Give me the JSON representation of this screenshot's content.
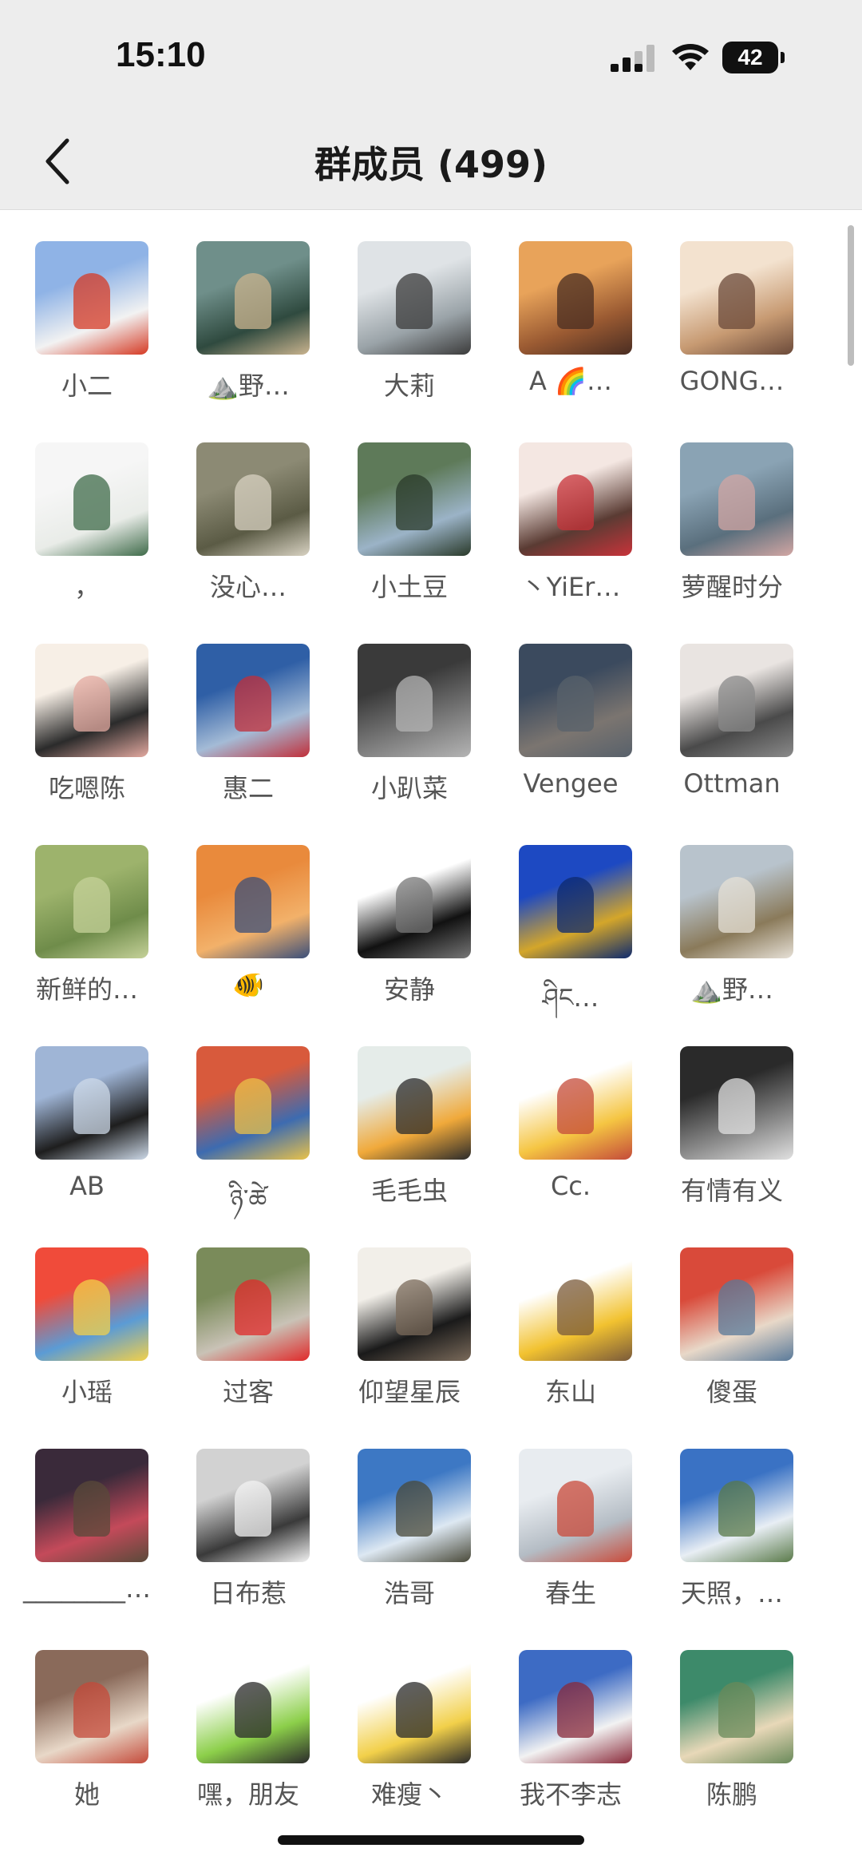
{
  "status": {
    "time": "15:10",
    "battery": "42"
  },
  "nav": {
    "title": "群成员 (499)"
  },
  "members": [
    {
      "name": "小二",
      "avatar": "snow-hiker-photo",
      "colors": [
        "#8fb3e6",
        "#f2f2f2",
        "#d53a24"
      ]
    },
    {
      "name": "⛰️野…",
      "avatar": "cat-lake-photo",
      "colors": [
        "#6f8f8a",
        "#2f4a3f",
        "#c9b38e"
      ]
    },
    {
      "name": "大莉",
      "avatar": "woman-snow-photo",
      "colors": [
        "#dfe3e6",
        "#9aa3a8",
        "#3b3b3b"
      ]
    },
    {
      "name": "A 🌈…",
      "avatar": "sunset-woman-photo",
      "colors": [
        "#e8a35a",
        "#9a5a32",
        "#4a2d22"
      ]
    },
    {
      "name": "GONG…",
      "avatar": "baby-cake-photo",
      "colors": [
        "#f3e2cf",
        "#c79a72",
        "#6b4a3a"
      ]
    },
    {
      "name": "，",
      "avatar": "agave-plant-photo",
      "colors": [
        "#f6f6f6",
        "#e9ece8",
        "#3f6b4a"
      ]
    },
    {
      "name": "没心…",
      "avatar": "forest-photo",
      "colors": [
        "#8c8a74",
        "#5b5b45",
        "#d8d2c2"
      ]
    },
    {
      "name": "小土豆",
      "avatar": "hill-person-photo",
      "colors": [
        "#5e7a59",
        "#9bb3c7",
        "#2a3a2a"
      ]
    },
    {
      "name": "丶YiEr…",
      "avatar": "girl-illustration",
      "colors": [
        "#f4e7e2",
        "#5a3b33",
        "#c8333a"
      ]
    },
    {
      "name": "萝醒时分",
      "avatar": "lake-woman-photo",
      "colors": [
        "#8aa3b4",
        "#5a6f7d",
        "#d2a6a3"
      ]
    },
    {
      "name": "吃嗯陈",
      "avatar": "meditation-illustration",
      "colors": [
        "#f7efe6",
        "#2b2b2b",
        "#e3a9a0"
      ]
    },
    {
      "name": "惠二",
      "avatar": "mountain-hiker-photo",
      "colors": [
        "#2f5fa6",
        "#a4bbd6",
        "#c12f3a"
      ]
    },
    {
      "name": "小趴菜",
      "avatar": "dark-portrait-photo",
      "colors": [
        "#3a3a3a",
        "#7d7d7d",
        "#b4b4b4"
      ]
    },
    {
      "name": "Vengee",
      "avatar": "abstract-photo",
      "colors": [
        "#3b4a5e",
        "#7b7570",
        "#58616b"
      ]
    },
    {
      "name": "Ottman",
      "avatar": "soldier-sketch",
      "colors": [
        "#e9e4e1",
        "#4a4a4a",
        "#8a8a8a"
      ]
    },
    {
      "name": "新鲜的…",
      "avatar": "green-field-photo",
      "colors": [
        "#9db36c",
        "#6f8c4a",
        "#c5d199"
      ]
    },
    {
      "name": "🐠",
      "avatar": "sunset-mountains-photo",
      "colors": [
        "#e98a3c",
        "#f2b16a",
        "#3b4f7a"
      ]
    },
    {
      "name": "安静",
      "avatar": "anime-boy-sketch",
      "colors": [
        "#ffffff",
        "#111111",
        "#777777"
      ]
    },
    {
      "name": "ཤིང…",
      "avatar": "golden-statue-photo",
      "colors": [
        "#1d49c2",
        "#d4a62a",
        "#0e2a6e"
      ]
    },
    {
      "name": "⛰️野…",
      "avatar": "field-person-photo",
      "colors": [
        "#b8c3cc",
        "#8a7a5a",
        "#e6e0d6"
      ]
    },
    {
      "name": "AB",
      "avatar": "hooded-figure-photo",
      "colors": [
        "#9fb5d6",
        "#1e1e1e",
        "#cdd9e8"
      ]
    },
    {
      "name": "ཉི་ཚེ",
      "avatar": "prayer-flags-photo",
      "colors": [
        "#d85a3c",
        "#3d6bb0",
        "#e9c24a"
      ]
    },
    {
      "name": "毛毛虫",
      "avatar": "scooter-cartoon",
      "colors": [
        "#e5ece9",
        "#f0a93a",
        "#2b2b2b"
      ]
    },
    {
      "name": "Cc.",
      "avatar": "brick-worker-cartoon",
      "colors": [
        "#ffffff",
        "#f5c542",
        "#c44b3a"
      ]
    },
    {
      "name": "有情有义",
      "avatar": "silhouette-sun-photo",
      "colors": [
        "#2a2a2a",
        "#8a8a8a",
        "#e0e0e0"
      ]
    },
    {
      "name": "小瑶",
      "avatar": "red-costume-photo",
      "colors": [
        "#f04b3a",
        "#5b9bd5",
        "#f2d04a"
      ]
    },
    {
      "name": "过客",
      "avatar": "stone-flag-photo",
      "colors": [
        "#7a8b5a",
        "#c9c2b6",
        "#e02a2a"
      ]
    },
    {
      "name": "仰望星辰",
      "avatar": "calligraphy-poster",
      "colors": [
        "#f2efe9",
        "#1a1a1a",
        "#7a6a5a"
      ]
    },
    {
      "name": "东山",
      "avatar": "fishing-cartoon",
      "colors": [
        "#ffffff",
        "#f2c230",
        "#7a5a3a"
      ]
    },
    {
      "name": "傻蛋",
      "avatar": "cap-man-photo",
      "colors": [
        "#d94a3a",
        "#e8d8c8",
        "#5a7a9a"
      ]
    },
    {
      "name": "________…",
      "avatar": "neon-street-photo",
      "colors": [
        "#3a2a3a",
        "#c44a5a",
        "#5a4a3a"
      ]
    },
    {
      "name": "日布惹",
      "avatar": "group-photo",
      "colors": [
        "#d2d2d2",
        "#3a3a3a",
        "#f2f2f2"
      ]
    },
    {
      "name": "浩哥",
      "avatar": "sea-of-clouds-photo",
      "colors": [
        "#3d78c4",
        "#dde8f2",
        "#4a4a3a"
      ]
    },
    {
      "name": "春生",
      "avatar": "snow-field-photo",
      "colors": [
        "#e8ecf0",
        "#b4bcc4",
        "#c94a3a"
      ]
    },
    {
      "name": "天照，…",
      "avatar": "mountain-road-photo",
      "colors": [
        "#3a72c4",
        "#e8eef4",
        "#5a7a4a"
      ]
    },
    {
      "name": "她",
      "avatar": "cat-meme-photo",
      "colors": [
        "#8a6a5a",
        "#e8d8c8",
        "#c44a3a"
      ]
    },
    {
      "name": "嘿，朋友",
      "avatar": "frog-cartoon",
      "colors": [
        "#ffffff",
        "#8ccf4a",
        "#2a2a2a"
      ]
    },
    {
      "name": "难瘦丶",
      "avatar": "dancing-cartoon",
      "colors": [
        "#ffffff",
        "#f2d04a",
        "#2a2a2a"
      ]
    },
    {
      "name": "我不李志",
      "avatar": "tibet-mountain-photo",
      "colors": [
        "#3d6bc4",
        "#f2f2f2",
        "#8a2a3a"
      ]
    },
    {
      "name": "陈鹏",
      "avatar": "jeep-illustration",
      "colors": [
        "#3d8a6a",
        "#e8d8b8",
        "#6a8a5a"
      ]
    }
  ]
}
